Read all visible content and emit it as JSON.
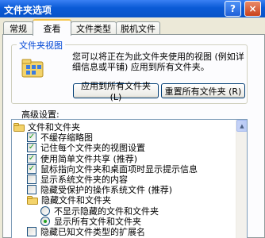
{
  "window": {
    "title": "文件夹选项",
    "help": "?",
    "close": "×"
  },
  "tabs": [
    {
      "label": "常规"
    },
    {
      "label": "查看"
    },
    {
      "label": "文件类型"
    },
    {
      "label": "脱机文件"
    }
  ],
  "folder_views": {
    "title": "文件夹视图",
    "description": "您可以将正在为此文件夹使用的视图 (例如详细信息或平铺) 应用到所有文件夹。",
    "apply_button": "应用到所有文件夹 (L)",
    "reset_button": "重置所有文件夹 (R)"
  },
  "advanced": {
    "label": "高级设置:",
    "items": [
      {
        "type": "folder",
        "label": "文件和文件夹"
      },
      {
        "type": "checkbox",
        "checked": true,
        "label": "不缓存缩略图"
      },
      {
        "type": "checkbox",
        "checked": true,
        "label": "记住每个文件夹的视图设置"
      },
      {
        "type": "checkbox",
        "checked": true,
        "label": "使用简单文件共享 (推荐)"
      },
      {
        "type": "checkbox",
        "checked": true,
        "label": "鼠标指向文件夹和桌面项时显示提示信息"
      },
      {
        "type": "checkbox",
        "checked": false,
        "label": "显示系统文件夹的内容"
      },
      {
        "type": "checkbox",
        "checked": false,
        "label": "隐藏受保护的操作系统文件 (推荐)"
      },
      {
        "type": "folder",
        "label": "隐藏文件和文件夹"
      },
      {
        "type": "radio",
        "checked": false,
        "label": "不显示隐藏的文件和文件夹"
      },
      {
        "type": "radio",
        "checked": true,
        "label": "显示所有文件和文件夹"
      },
      {
        "type": "checkbox",
        "checked": false,
        "label": "隐藏已知文件类型的扩展名"
      }
    ]
  },
  "check_glyph": "✓"
}
